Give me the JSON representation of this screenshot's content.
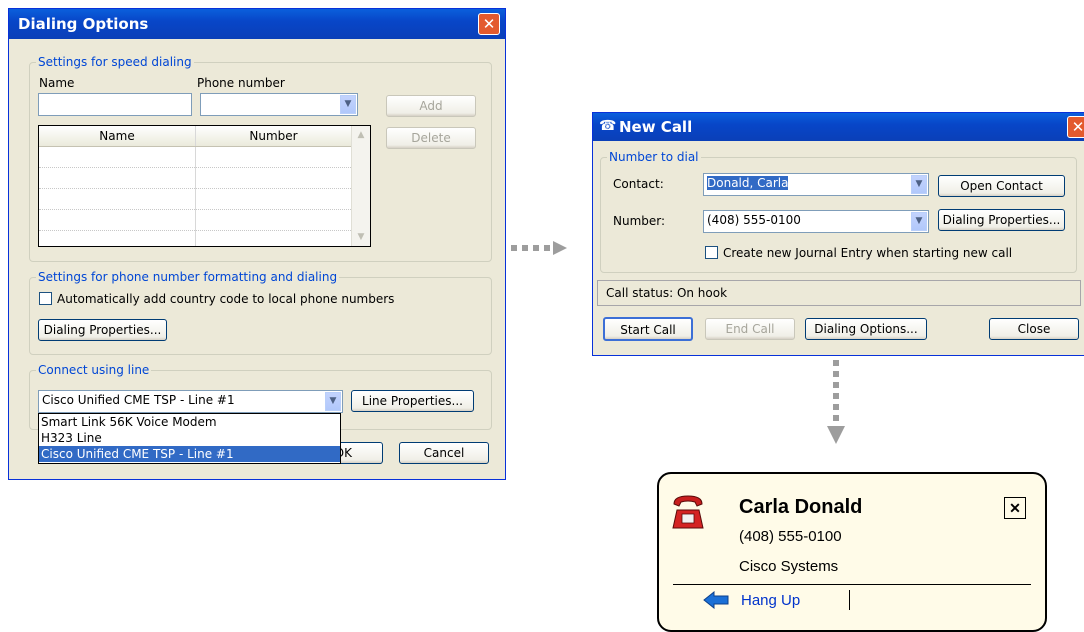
{
  "dialing_options": {
    "title": "Dialing Options",
    "speed_group": "Settings for speed dialing",
    "name_label": "Name",
    "phone_label": "Phone number",
    "add_label": "Add",
    "delete_label": "Delete",
    "table_headers": [
      "Name",
      "Number"
    ],
    "format_group": "Settings for phone number formatting and dialing",
    "auto_country_code": "Automatically add country code to local phone numbers",
    "dialing_properties": "Dialing Properties...",
    "connect_group": "Connect using line",
    "line_selected": "Cisco Unified CME TSP - Line #1",
    "line_properties": "Line Properties...",
    "line_options": [
      "Smart Link 56K Voice Modem",
      "H323 Line",
      "Cisco Unified CME TSP - Line #1"
    ],
    "ok_label": "OK",
    "cancel_label": "Cancel"
  },
  "new_call": {
    "title": "New Call",
    "group": "Number to dial",
    "contact_label": "Contact:",
    "contact_value": "Donald, Carla",
    "number_label": "Number:",
    "number_value": "(408) 555-0100",
    "open_contact": "Open Contact",
    "dialing_properties": "Dialing Properties...",
    "journal_checkbox": "Create new Journal Entry when starting new call",
    "call_status": "Call status:  On hook",
    "start_call": "Start Call",
    "end_call": "End Call",
    "dialing_options": "Dialing Options...",
    "close": "Close"
  },
  "call_popup": {
    "name": "Carla Donald",
    "number": "(408) 555-0100",
    "company": "Cisco Systems",
    "hang_up": "Hang Up",
    "close_glyph": "✕"
  },
  "colors": {
    "title_blue": "#0846c8",
    "group_label": "#0046d5",
    "selection": "#316ac5",
    "link_blue": "#0033cc",
    "arrow_blue": "#1a6fd6"
  },
  "icons": [
    "close-icon",
    "dropdown-arrow-icon",
    "phone-icon",
    "back-arrow-icon",
    "new-call-icon"
  ]
}
